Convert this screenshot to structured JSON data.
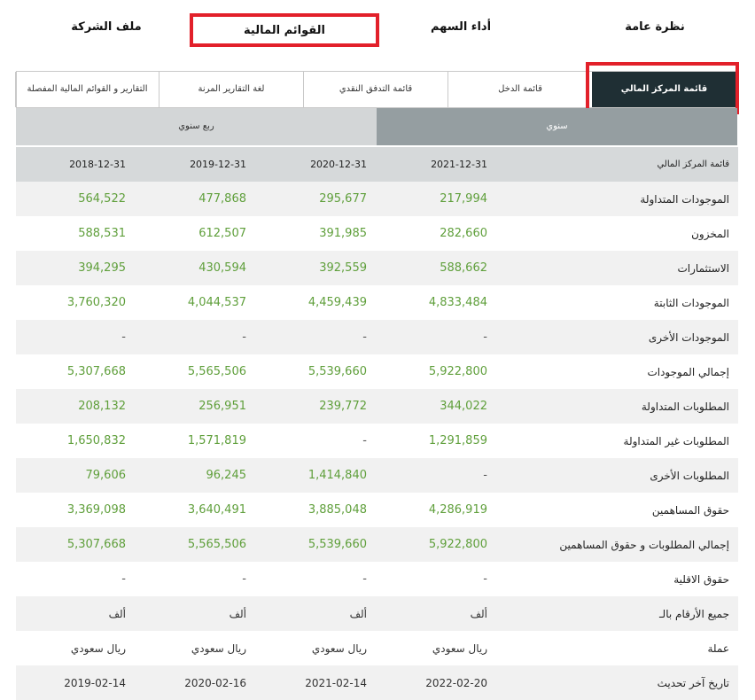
{
  "top_tabs": [
    {
      "label": "نظرة عامة"
    },
    {
      "label": "أداء السهم"
    },
    {
      "label": "القوائم المالية"
    },
    {
      "label": "ملف الشركة"
    }
  ],
  "sub_tabs": [
    {
      "label": "قائمة المركز المالي"
    },
    {
      "label": "قائمة الدخل"
    },
    {
      "label": "قائمة التدفق النقدي"
    },
    {
      "label": "لغة التقارير المرنة"
    },
    {
      "label": "التقارير و القوائم المالية المفصلة"
    }
  ],
  "periods": {
    "annual": "سنوي",
    "quarterly": "ربع سنوي"
  },
  "table": {
    "header_label": "قائمة المركز المالي",
    "dates": [
      "2021-12-31",
      "2020-12-31",
      "2019-12-31",
      "2018-12-31"
    ],
    "rows": [
      {
        "label": "الموجودات المتداولة",
        "values": [
          "217,994",
          "295,677",
          "477,868",
          "564,522"
        ]
      },
      {
        "label": "المخزون",
        "values": [
          "282,660",
          "391,985",
          "612,507",
          "588,531"
        ]
      },
      {
        "label": "الاستثمارات",
        "values": [
          "588,662",
          "392,559",
          "430,594",
          "394,295"
        ]
      },
      {
        "label": "الموجودات الثابتة",
        "values": [
          "4,833,484",
          "4,459,439",
          "4,044,537",
          "3,760,320"
        ]
      },
      {
        "label": "الموجودات الأخرى",
        "values": [
          "-",
          "-",
          "-",
          "-"
        ]
      },
      {
        "label": "إجمالي الموجودات",
        "values": [
          "5,922,800",
          "5,539,660",
          "5,565,506",
          "5,307,668"
        ]
      },
      {
        "label": "المطلوبات المتداولة",
        "values": [
          "344,022",
          "239,772",
          "256,951",
          "208,132"
        ]
      },
      {
        "label": "المطلوبات غير المتداولة",
        "values": [
          "1,291,859",
          "-",
          "1,571,819",
          "1,650,832"
        ]
      },
      {
        "label": "المطلوبات الأخرى",
        "values": [
          "-",
          "1,414,840",
          "96,245",
          "79,606"
        ]
      },
      {
        "label": "حقوق المساهمين",
        "values": [
          "4,286,919",
          "3,885,048",
          "3,640,491",
          "3,369,098"
        ]
      },
      {
        "label": "إجمالي المطلوبات و حقوق المساهمين",
        "values": [
          "5,922,800",
          "5,539,660",
          "5,565,506",
          "5,307,668"
        ]
      },
      {
        "label": "حقوق الاقلية",
        "values": [
          "-",
          "-",
          "-",
          "-"
        ]
      },
      {
        "label": "جميع الأرقام بالـ",
        "values": [
          "ألف",
          "ألف",
          "ألف",
          "ألف"
        ]
      },
      {
        "label": "عملة",
        "values": [
          "ريال سعودي",
          "ريال سعودي",
          "ريال سعودي",
          "ريال سعودي"
        ]
      },
      {
        "label": "تاريخ آخر تحديث",
        "values": [
          "2022-02-20",
          "2021-02-14",
          "2020-02-16",
          "2019-02-14"
        ]
      }
    ]
  },
  "colors": {
    "positive_value": "#5f9f3b",
    "active_tab_bg": "#1f2f34",
    "highlight_border": "#e2202a",
    "annual_bg": "#959ea1",
    "quarterly_bg": "#d3d6d7"
  }
}
